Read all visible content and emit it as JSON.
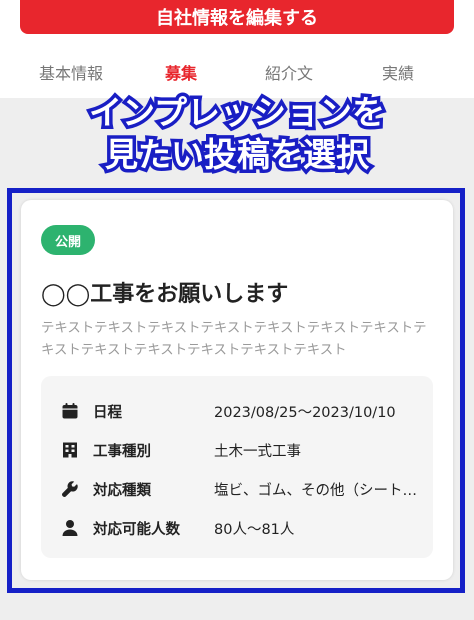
{
  "header": {
    "edit_button_label": "自社情報を編集する"
  },
  "tabs": [
    {
      "label": "基本情報",
      "active": false
    },
    {
      "label": "募集",
      "active": true
    },
    {
      "label": "紹介文",
      "active": false
    },
    {
      "label": "実績",
      "active": false
    }
  ],
  "annotation": {
    "line1": "インプレッションを",
    "line2": "見たい投稿を選択"
  },
  "post_card": {
    "status_badge": "公開",
    "title": "◯◯工事をお願いします",
    "description": "テキストテキストテキストテキストテキストテキストテキストテキストテキストテキストテキストテキストテキスト",
    "details": [
      {
        "icon": "calendar-icon",
        "label": "日程",
        "value": "2023/08/25〜2023/10/10"
      },
      {
        "icon": "building-icon",
        "label": "工事種別",
        "value": "土木一式工事"
      },
      {
        "icon": "wrench-icon",
        "label": "対応種類",
        "value": "塩ビ、ゴム、その他（シート防水）"
      },
      {
        "icon": "person-icon",
        "label": "対応可能人数",
        "value": "80人〜81人"
      }
    ]
  },
  "colors": {
    "accent_red": "#e8262d",
    "badge_green": "#2db36f",
    "annotation_blue": "#1520c7"
  }
}
